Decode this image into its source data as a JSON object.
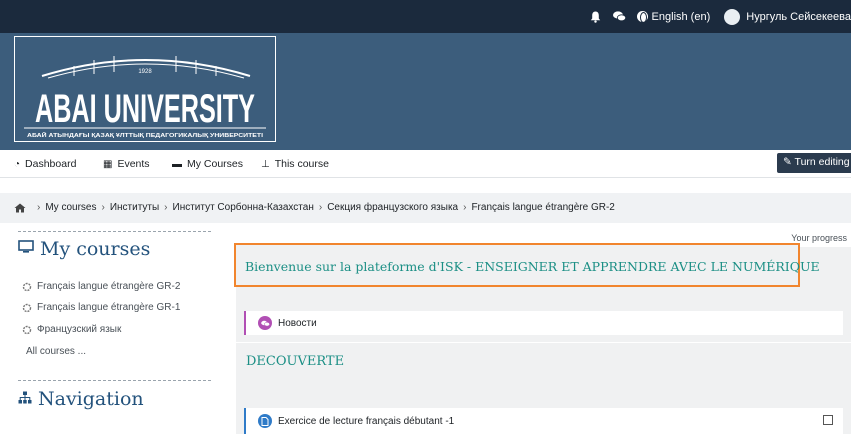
{
  "topbar": {
    "notification_icon": "bell-icon",
    "messages_icon": "chat-bubbles-icon",
    "language": "English (en)",
    "user_name": "Нургуль Сейсекеева"
  },
  "banner": {
    "logo_year": "1928",
    "logo_wordmark": "ABAI UNIVERSITY",
    "logo_subtitle": "АБАЙ АТЫНДАҒЫ ҚАЗАҚ ҰЛТТЫҚ ПЕДАГОГИКАЛЫҚ УНИВЕРСИТЕТІ"
  },
  "nav": {
    "dashboard": "Dashboard",
    "events": "Events",
    "my_courses": "My Courses",
    "this_course": "This course",
    "turn_editing": "Turn editing on"
  },
  "breadcrumb": {
    "items": [
      "My courses",
      "Институты",
      "Институт Сорбонна-Казахстан",
      "Секция французского языка",
      "Français langue étrangère GR-2"
    ]
  },
  "sidebar": {
    "my_courses_title": "My courses",
    "courses": [
      "Français langue étrangère GR-2",
      "Français langue étrangère GR-1",
      "Французский язык"
    ],
    "all_courses": "All courses ...",
    "navigation_title": "Navigation"
  },
  "main": {
    "progress_label": "Your progress",
    "welcome_title": "Bienvenue sur la plateforme d'ISK - ENSEIGNER ET APPRENDRE AVEC LE NUMÉRIQUE",
    "news_activity": "Новости",
    "section_title": "DECOUVERTE",
    "exercise_activity": "Exercice de lecture français débutant -1"
  },
  "colors": {
    "topbar": "#1b2a3d",
    "banner": "#3c5d7c",
    "highlight": "#f1852e",
    "section_text": "#1b8f85",
    "forum_accent": "#b14fb4",
    "resource_accent": "#2f7bc8"
  }
}
